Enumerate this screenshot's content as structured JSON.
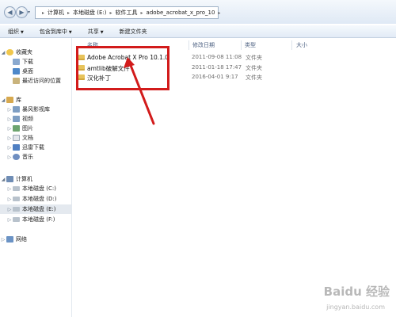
{
  "address": {
    "crumbs": [
      "计算机",
      "本地磁盘 (E:)",
      "软件工具",
      "adobe_acrobat_x_pro_10"
    ]
  },
  "toolbar": {
    "organize": "组织",
    "include_in_library": "包含到库中",
    "share": "共享",
    "new_folder": "新建文件夹"
  },
  "columns": {
    "name": "名称",
    "modified": "修改日期",
    "type": "类型",
    "size": "大小"
  },
  "files": [
    {
      "name": "Adobe Acrobat X Pro 10.1.0",
      "modified": "2011-09-08 11:08",
      "type": "文件夹"
    },
    {
      "name": "amtlib破解文件",
      "modified": "2011-01-18 17:47",
      "type": "文件夹"
    },
    {
      "name": "汉化补丁",
      "modified": "2016-04-01 9:17",
      "type": "文件夹"
    }
  ],
  "sidebar": {
    "favorites": {
      "label": "收藏夹",
      "items": [
        "下载",
        "桌面",
        "最近访问的位置"
      ]
    },
    "libraries": {
      "label": "库",
      "items": [
        "暴风影视库",
        "视频",
        "图片",
        "文档",
        "迅雷下载",
        "音乐"
      ]
    },
    "computer": {
      "label": "计算机",
      "items": [
        "本地磁盘 (C:)",
        "本地磁盘 (D:)",
        "本地磁盘 (E:)",
        "本地磁盘 (F:)"
      ]
    },
    "network": {
      "label": "网络"
    }
  },
  "colors": {
    "annotation": "#d21b1b",
    "folder": "#e7c35b"
  },
  "watermark": {
    "main": "Baidu 经验",
    "sub": "jingyan.baidu.com"
  }
}
